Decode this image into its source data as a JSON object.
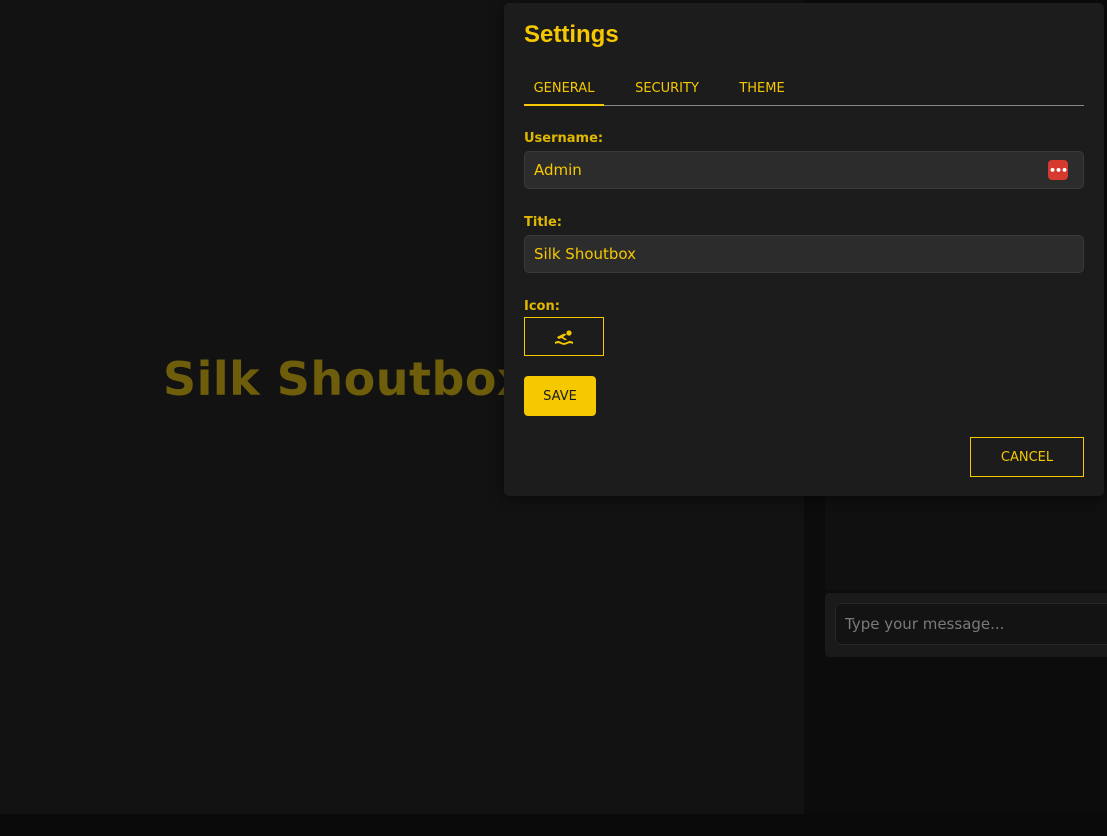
{
  "app": {
    "brand_title": "Silk Shoutbox",
    "accent_color": "#f5c800"
  },
  "composer": {
    "placeholder": "Type your message..."
  },
  "settings_dialog": {
    "title": "Settings",
    "tabs": [
      {
        "label": "GENERAL",
        "active": true
      },
      {
        "label": "SECURITY",
        "active": false
      },
      {
        "label": "THEME",
        "active": false
      }
    ],
    "fields": {
      "username": {
        "label": "Username:",
        "value": "Admin"
      },
      "title": {
        "label": "Title:",
        "value": "Silk Shoutbox"
      },
      "icon": {
        "label": "Icon:",
        "icon_name": "swimmer-icon"
      }
    },
    "save_label": "SAVE",
    "cancel_label": "CANCEL",
    "password_manager_icon": "password-manager-icon"
  }
}
